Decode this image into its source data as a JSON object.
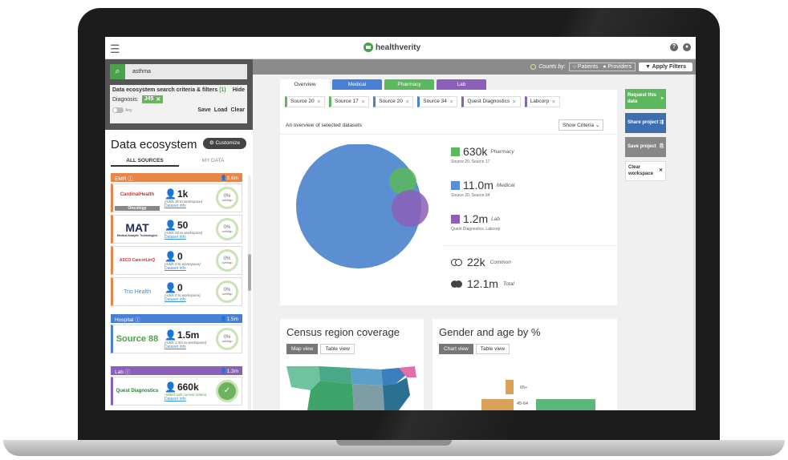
{
  "header": {
    "brand": "healthverity"
  },
  "filterbar": {
    "counts_by": "Counts by:",
    "patients": "Patients",
    "providers": "Providers",
    "apply_label": "Apply Filters"
  },
  "search": {
    "query": "asthma"
  },
  "criteria": {
    "title": "Data ecosystem search criteria & filters",
    "count": "(1)",
    "hide": "Hide",
    "diagnosis_label": "Diagnosis:",
    "diagnosis_code": "J45",
    "any_label": "Any",
    "save": "Save",
    "load": "Load",
    "clear": "Clear"
  },
  "ecosystem": {
    "title": "Data ecosystem",
    "customize": "Customize",
    "tab_all": "ALL SOURCES",
    "tab_mine": "MY DATA"
  },
  "categories": [
    {
      "name": "EMR",
      "count": "3.6m",
      "color": "#e8864a"
    },
    {
      "name": "Hospital",
      "count": "1.5m",
      "color": "#4a7fd6"
    },
    {
      "name": "Lab",
      "count": "1.3m",
      "color": "#8c5fb8"
    }
  ],
  "cards": [
    {
      "logo": "CardinalHealth",
      "tag": "Oncology",
      "count": "1k",
      "sub": "(Adds 1k to workspace)",
      "link": "Dataset info",
      "overlap": "0%",
      "overlap_label": "overlap"
    },
    {
      "logo": "MAT",
      "logo_sub": "Medical Analytic Technologies",
      "count": "50",
      "sub": "(Adds 50 to workspace)",
      "link": "Dataset info",
      "overlap": "0%",
      "overlap_label": "overlap"
    },
    {
      "logo": "ASCO CancerLinQ",
      "count": "0",
      "sub": "(Adds 0 to workspace)",
      "link": "Dataset info",
      "overlap": "0%",
      "overlap_label": "overlap"
    },
    {
      "logo": "Trio Health",
      "count": "0",
      "sub": "(Adds 0 to workspace)",
      "link": "Dataset info",
      "overlap": "0%",
      "overlap_label": "overlap"
    },
    {
      "logo": "Source 88",
      "count": "1.5m",
      "sub": "(Adds 1.5m to workspace)",
      "link": "Dataset info",
      "overlap": "0%",
      "overlap_label": "overlap"
    },
    {
      "logo": "Quest Diagnostics",
      "count": "660k",
      "sub": "Added with current criteria",
      "link": "Dataset info"
    }
  ],
  "tabs": [
    {
      "label": "Overview",
      "color": "#ffffff"
    },
    {
      "label": "Medical",
      "color": "#4a7fd6"
    },
    {
      "label": "Pharmacy",
      "color": "#5cb85c"
    },
    {
      "label": "Lab",
      "color": "#8c5fb8"
    }
  ],
  "chips": [
    {
      "label": "Source 20",
      "color": "#5cb85c"
    },
    {
      "label": "Source 17",
      "color": "#5cb85c"
    },
    {
      "label": "Source 20",
      "color": "#4a7fd6"
    },
    {
      "label": "Source 34",
      "color": "#4a7fd6"
    },
    {
      "label": "Quest Diagnostics",
      "color": "#8c5fb8"
    },
    {
      "label": "Labcorp",
      "color": "#8c5fb8"
    }
  ],
  "overview": {
    "description": "An overview of selected datasets",
    "show_criteria": "Show Criteria",
    "legend": [
      {
        "value": "630k",
        "name": "Pharmacy",
        "sources": "Source 20, Source 17",
        "color": "#5cb85c"
      },
      {
        "value": "11.0m",
        "name": "Medical",
        "sources": "Source 20, Source 34",
        "color": "#5b8fd1"
      },
      {
        "value": "1.2m",
        "name": "Lab",
        "sources": "Quest Diagnostics, Labcorp",
        "color": "#8c5fb8"
      }
    ],
    "common": {
      "value": "22k",
      "name": "Common"
    },
    "total": {
      "value": "12.1m",
      "name": "Total"
    }
  },
  "actions": [
    {
      "label": "Request this data",
      "color": "#5cb85c",
      "icon": "▸"
    },
    {
      "label": "Share project",
      "color": "#3d6fb0",
      "icon": "⇶"
    },
    {
      "label": "Save project",
      "color": "#888888",
      "icon": "⎘"
    },
    {
      "label": "Clear workspace",
      "color": "#ffffff",
      "icon": "✕"
    }
  ],
  "census": {
    "title": "Census region coverage",
    "tab_map": "Map view",
    "tab_table": "Table view"
  },
  "gender_age": {
    "title": "Gender and age by %",
    "tab_chart": "Chart view",
    "tab_table": "Table view",
    "labels": [
      "65+",
      "45-64"
    ]
  }
}
